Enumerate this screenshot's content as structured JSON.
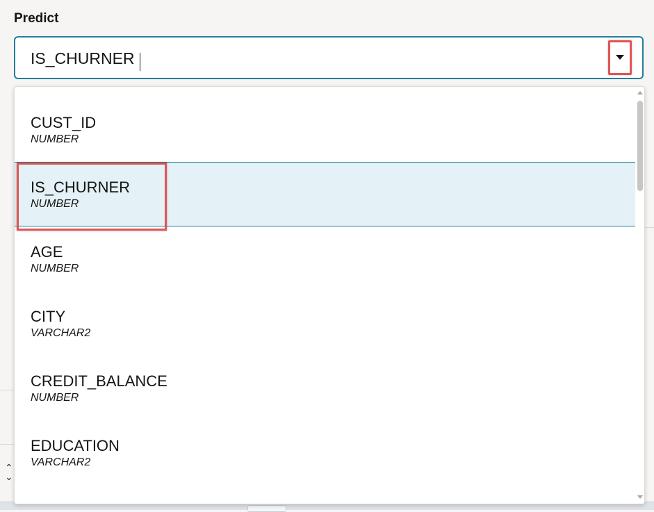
{
  "predict": {
    "label": "Predict",
    "value": "IS_CHURNER"
  },
  "options": [
    {
      "name": "CUST_ID",
      "type": "NUMBER",
      "selected": false
    },
    {
      "name": "IS_CHURNER",
      "type": "NUMBER",
      "selected": true
    },
    {
      "name": "AGE",
      "type": "NUMBER",
      "selected": false
    },
    {
      "name": "CITY",
      "type": "VARCHAR2",
      "selected": false
    },
    {
      "name": "CREDIT_BALANCE",
      "type": "NUMBER",
      "selected": false
    },
    {
      "name": "EDUCATION",
      "type": "VARCHAR2",
      "selected": false
    }
  ],
  "colors": {
    "focus_border": "#227e9e",
    "selected_bg": "#e4f1f7",
    "annotation_red": "#e15552",
    "text": "#161513"
  },
  "icons": {
    "dropdown": "caret-down-icon",
    "sort": "sort-arrows-icon"
  }
}
